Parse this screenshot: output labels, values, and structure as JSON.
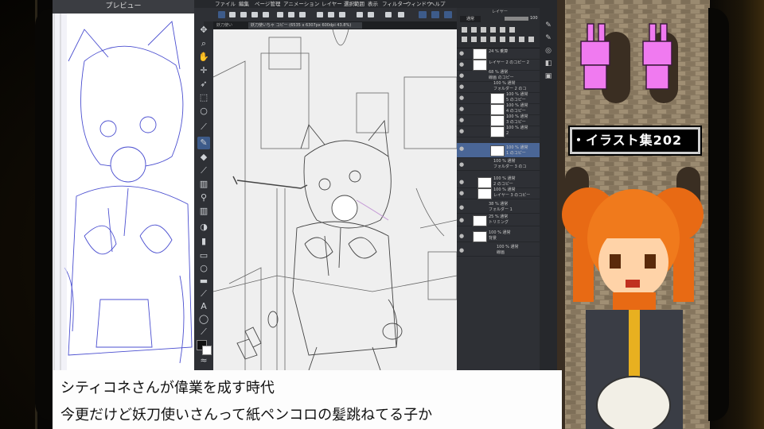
{
  "preview": {
    "title": "プレビュー"
  },
  "menu": [
    "ファイル",
    "編集",
    "ページ管理",
    "アニメーション",
    "レイヤー",
    "選択範囲",
    "表示",
    "フィルター",
    "ウィンドウ",
    "ヘルプ"
  ],
  "document_tab": "妖刀使いちゃ コピー (6535 x 6307px 600dpi 43.8%)",
  "left_tab_label": "妖刀使い",
  "layer_panel": {
    "header": "レイヤー",
    "opacity_value": "100",
    "layers": [
      {
        "text": "24 % 乗算",
        "sub": ""
      },
      {
        "text": "レイヤー 2 のコピー 2",
        "sub": ""
      },
      {
        "text": "68 % 通常",
        "sub": "線画 のコピー"
      },
      {
        "text": "100 % 通常",
        "sub": "フォルダー 2 のコ"
      },
      {
        "text": "100 % 通常",
        "sub": "5 のコピー"
      },
      {
        "text": "100 % 通常",
        "sub": "4 のコピー"
      },
      {
        "text": "100 % 通常",
        "sub": "3 のコピー"
      },
      {
        "text": "100 % 通常",
        "sub": "2"
      },
      {
        "text": "100 % 通常",
        "sub": "1 のコピー"
      },
      {
        "text": "100 % 通常",
        "sub": "フォルダー 3 のコ"
      },
      {
        "text": "100 % 通常",
        "sub": "2 のコピー"
      },
      {
        "text": "100 % 通常",
        "sub": "レイヤー 3 のコピー"
      },
      {
        "text": "38 % 通常",
        "sub": "フォルダー 1"
      },
      {
        "text": "25 % 通常",
        "sub": "トリミング"
      },
      {
        "text": "100 % 通常",
        "sub": "背景"
      },
      {
        "text": "100 % 通常",
        "sub": "線画"
      }
    ]
  },
  "banner": {
    "text": "・イラスト集202"
  },
  "subtitles": [
    "シティコネさんが偉業を成す時代",
    "今更だけど妖刀使いさんって紙ペンコロの髪跳ねてる子か"
  ],
  "icons": {
    "tools": [
      "move-icon",
      "zoom-icon",
      "hand-icon",
      "rotate-icon",
      "select-icon",
      "lasso-icon",
      "eyedropper-icon",
      "pen-icon",
      "eraser-icon",
      "brush-icon",
      "airbrush-icon",
      "blend-icon",
      "fill-icon",
      "gradient-icon",
      "figure-icon",
      "frame-icon",
      "ruler-icon",
      "text-icon",
      "balloon-icon",
      "correct-icon",
      "color-icon"
    ],
    "dock": [
      "sub-tool-icon",
      "tool-property-icon",
      "brush-size-icon",
      "color-wheel-icon",
      "navigator-icon",
      "layer-icon"
    ]
  },
  "colors": {
    "accent": "#4a6696",
    "panel": "#2e3035",
    "banner_bg": "#000000",
    "banner_border": "#d0d0d0"
  }
}
